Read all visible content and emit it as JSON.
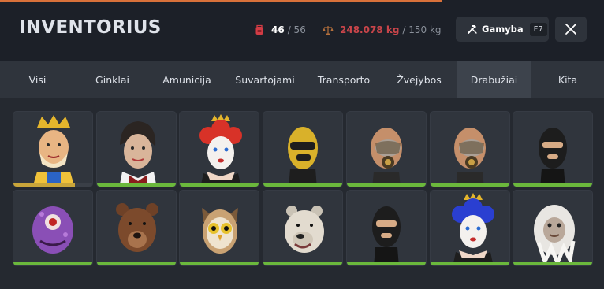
{
  "app": {
    "title": "INVENTORIUS"
  },
  "stats": {
    "slots_used": "46",
    "slots_max": "/ 56",
    "weight_used": "248.078 kg",
    "weight_max": "/ 150 kg",
    "slots_icon": "backpack-icon",
    "weight_icon": "scale-icon"
  },
  "toolbar": {
    "craft_label": "Gamyba",
    "craft_key": "F7",
    "craft_icon": "hammer-icon",
    "close_icon": "close-icon"
  },
  "tabs": [
    {
      "label": "Visi",
      "active": false
    },
    {
      "label": "Ginklai",
      "active": false
    },
    {
      "label": "Amunicija",
      "active": false
    },
    {
      "label": "Suvartojami",
      "active": false
    },
    {
      "label": "Transporto",
      "active": false
    },
    {
      "label": "Žvejybos",
      "active": false
    },
    {
      "label": "Drabužiai",
      "active": true
    },
    {
      "label": "Kita",
      "active": false
    }
  ],
  "items": [
    {
      "icon": "king-mask-icon",
      "durability": 0.78,
      "bar_color": "#c9a53a"
    },
    {
      "icon": "woman-mask-icon",
      "durability": 1.0,
      "bar_color": "#6bb83c"
    },
    {
      "icon": "red-queen-mask-icon",
      "durability": 1.0,
      "bar_color": "#6bb83c"
    },
    {
      "icon": "yellow-ski-mask-icon",
      "durability": 1.0,
      "bar_color": "#6bb83c"
    },
    {
      "icon": "gas-mask-icon",
      "durability": 1.0,
      "bar_color": "#6bb83c"
    },
    {
      "icon": "gas-mask-icon",
      "durability": 1.0,
      "bar_color": "#6bb83c"
    },
    {
      "icon": "black-balaclava-icon",
      "durability": 1.0,
      "bar_color": "#6bb83c"
    },
    {
      "icon": "purple-alien-mask-icon",
      "durability": 1.0,
      "bar_color": "#6bb83c"
    },
    {
      "icon": "bear-mask-icon",
      "durability": 1.0,
      "bar_color": "#6bb83c"
    },
    {
      "icon": "owl-mask-icon",
      "durability": 1.0,
      "bar_color": "#6bb83c"
    },
    {
      "icon": "polar-bear-mask-icon",
      "durability": 1.0,
      "bar_color": "#6bb83c"
    },
    {
      "icon": "black-balaclava-icon",
      "durability": 1.0,
      "bar_color": "#6bb83c"
    },
    {
      "icon": "blue-queen-mask-icon",
      "durability": 1.0,
      "bar_color": "#6bb83c"
    },
    {
      "icon": "white-yeti-mask-icon",
      "durability": 1.0,
      "bar_color": "#6bb83c"
    }
  ],
  "colors": {
    "accent": "#d8713a",
    "weight_over": "#c9454a",
    "durability_ok": "#6bb83c",
    "durability_warn": "#c9a53a"
  }
}
